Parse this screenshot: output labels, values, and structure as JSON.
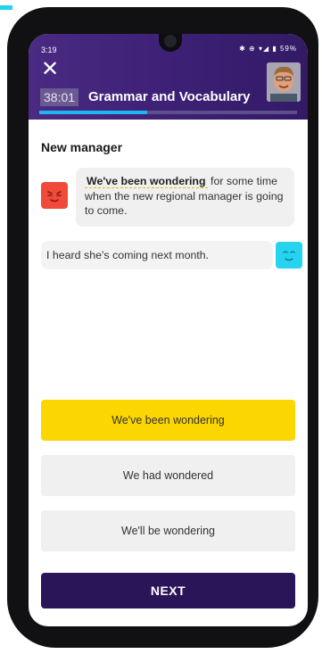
{
  "status_bar": {
    "time": "3:19",
    "icons": "✱ ⊕ ▾◢ ▮ 59%"
  },
  "header": {
    "timer": "38:01",
    "title": "Grammar and Vocabulary",
    "close_icon": "close-icon",
    "progress_fraction": 0.42,
    "accent_color": "#1fb6ef",
    "header_color": "#3b1f73"
  },
  "question": {
    "title": "New manager",
    "prompt_gap": "We've been wondering",
    "prompt_rest": "for some time when the new regional manager is going to come.",
    "reply": "I heard she's coming next month."
  },
  "options": [
    {
      "label": "We've been wondering",
      "selected": true,
      "color": "#fcd600"
    },
    {
      "label": "We had wondered",
      "selected": false
    },
    {
      "label": "We'll be wondering",
      "selected": false
    }
  ],
  "next_label": "NEXT",
  "next_color": "#2a1559"
}
